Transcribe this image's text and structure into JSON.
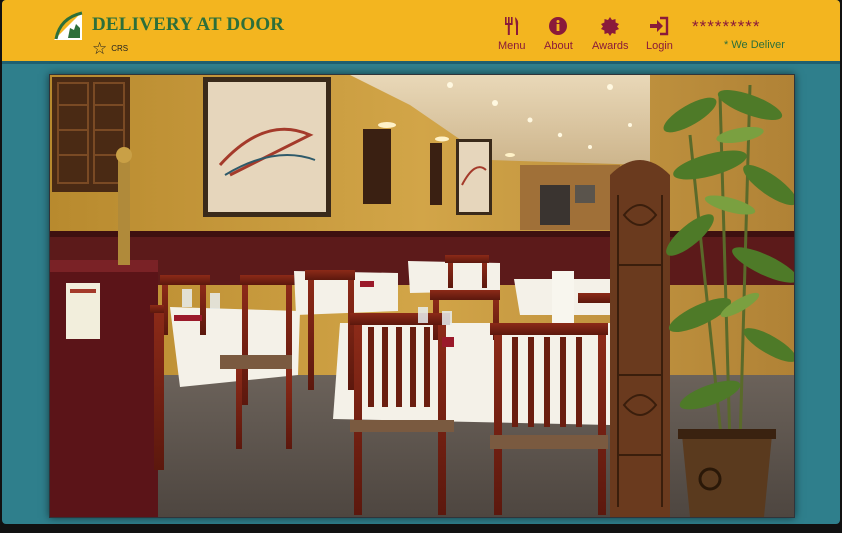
{
  "brand": {
    "name": "DELIVERY AT DOOR",
    "sub_label": "CRS"
  },
  "nav": [
    {
      "label": "Menu",
      "icon": "fork-knife-icon"
    },
    {
      "label": "About",
      "icon": "info-icon"
    },
    {
      "label": "Awards",
      "icon": "award-seal-icon"
    },
    {
      "label": "Login",
      "icon": "login-icon"
    }
  ],
  "header": {
    "masked": "*********",
    "tagline": "* We Deliver"
  },
  "colors": {
    "header_bg": "#f3b51f",
    "teal_bg": "#2f7f8c",
    "accent_maroon": "#8a1a3a",
    "brand_green": "#2d6f3a"
  }
}
